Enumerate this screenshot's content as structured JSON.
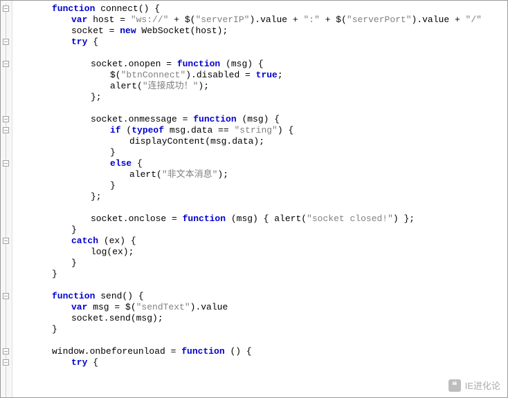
{
  "code": {
    "lines": [
      {
        "indent": 2,
        "tokens": [
          {
            "t": "kw",
            "v": "function"
          },
          {
            "t": "pl",
            "v": " connect() {"
          }
        ]
      },
      {
        "indent": 3,
        "tokens": [
          {
            "t": "kw",
            "v": "var"
          },
          {
            "t": "pl",
            "v": " host = "
          },
          {
            "t": "str",
            "v": "\"ws://\""
          },
          {
            "t": "pl",
            "v": " + $("
          },
          {
            "t": "str",
            "v": "\"serverIP\""
          },
          {
            "t": "pl",
            "v": ").value + "
          },
          {
            "t": "str",
            "v": "\":\""
          },
          {
            "t": "pl",
            "v": " + $("
          },
          {
            "t": "str",
            "v": "\"serverPort\""
          },
          {
            "t": "pl",
            "v": ").value + "
          },
          {
            "t": "str",
            "v": "\"/\""
          }
        ]
      },
      {
        "indent": 3,
        "tokens": [
          {
            "t": "pl",
            "v": "socket = "
          },
          {
            "t": "kw",
            "v": "new"
          },
          {
            "t": "pl",
            "v": " WebSocket(host);"
          }
        ]
      },
      {
        "indent": 3,
        "tokens": [
          {
            "t": "kw",
            "v": "try"
          },
          {
            "t": "pl",
            "v": " {"
          }
        ]
      },
      {
        "indent": 0,
        "tokens": []
      },
      {
        "indent": 4,
        "tokens": [
          {
            "t": "pl",
            "v": "socket.onopen = "
          },
          {
            "t": "kw",
            "v": "function"
          },
          {
            "t": "pl",
            "v": " (msg) {"
          }
        ]
      },
      {
        "indent": 5,
        "tokens": [
          {
            "t": "pl",
            "v": "$("
          },
          {
            "t": "str",
            "v": "\"btnConnect\""
          },
          {
            "t": "pl",
            "v": ").disabled = "
          },
          {
            "t": "kw",
            "v": "true"
          },
          {
            "t": "pl",
            "v": ";"
          }
        ]
      },
      {
        "indent": 5,
        "tokens": [
          {
            "t": "pl",
            "v": "alert("
          },
          {
            "t": "str",
            "v": "\"连接成功！\""
          },
          {
            "t": "pl",
            "v": ");"
          }
        ]
      },
      {
        "indent": 4,
        "tokens": [
          {
            "t": "pl",
            "v": "};"
          }
        ]
      },
      {
        "indent": 0,
        "tokens": []
      },
      {
        "indent": 4,
        "tokens": [
          {
            "t": "pl",
            "v": "socket.onmessage = "
          },
          {
            "t": "kw",
            "v": "function"
          },
          {
            "t": "pl",
            "v": " (msg) {"
          }
        ]
      },
      {
        "indent": 5,
        "tokens": [
          {
            "t": "kw",
            "v": "if"
          },
          {
            "t": "pl",
            "v": " ("
          },
          {
            "t": "kw",
            "v": "typeof"
          },
          {
            "t": "pl",
            "v": " msg.data == "
          },
          {
            "t": "str",
            "v": "\"string\""
          },
          {
            "t": "pl",
            "v": ") {"
          }
        ]
      },
      {
        "indent": 6,
        "tokens": [
          {
            "t": "pl",
            "v": "displayContent(msg.data);"
          }
        ]
      },
      {
        "indent": 5,
        "tokens": [
          {
            "t": "pl",
            "v": "}"
          }
        ]
      },
      {
        "indent": 5,
        "tokens": [
          {
            "t": "kw",
            "v": "else"
          },
          {
            "t": "pl",
            "v": " {"
          }
        ]
      },
      {
        "indent": 6,
        "tokens": [
          {
            "t": "pl",
            "v": "alert("
          },
          {
            "t": "str",
            "v": "\"非文本消息\""
          },
          {
            "t": "pl",
            "v": ");"
          }
        ]
      },
      {
        "indent": 5,
        "tokens": [
          {
            "t": "pl",
            "v": "}"
          }
        ]
      },
      {
        "indent": 4,
        "tokens": [
          {
            "t": "pl",
            "v": "};"
          }
        ]
      },
      {
        "indent": 0,
        "tokens": []
      },
      {
        "indent": 4,
        "tokens": [
          {
            "t": "pl",
            "v": "socket.onclose = "
          },
          {
            "t": "kw",
            "v": "function"
          },
          {
            "t": "pl",
            "v": " (msg) { alert("
          },
          {
            "t": "str",
            "v": "\"socket closed!\""
          },
          {
            "t": "pl",
            "v": ") };"
          }
        ]
      },
      {
        "indent": 3,
        "tokens": [
          {
            "t": "pl",
            "v": "}"
          }
        ]
      },
      {
        "indent": 3,
        "tokens": [
          {
            "t": "kw",
            "v": "catch"
          },
          {
            "t": "pl",
            "v": " (ex) {"
          }
        ]
      },
      {
        "indent": 4,
        "tokens": [
          {
            "t": "pl",
            "v": "log(ex);"
          }
        ]
      },
      {
        "indent": 3,
        "tokens": [
          {
            "t": "pl",
            "v": "}"
          }
        ]
      },
      {
        "indent": 2,
        "tokens": [
          {
            "t": "pl",
            "v": "}"
          }
        ]
      },
      {
        "indent": 0,
        "tokens": []
      },
      {
        "indent": 2,
        "tokens": [
          {
            "t": "kw",
            "v": "function"
          },
          {
            "t": "pl",
            "v": " send() {"
          }
        ]
      },
      {
        "indent": 3,
        "tokens": [
          {
            "t": "kw",
            "v": "var"
          },
          {
            "t": "pl",
            "v": " msg = $("
          },
          {
            "t": "str",
            "v": "\"sendText\""
          },
          {
            "t": "pl",
            "v": ").value"
          }
        ]
      },
      {
        "indent": 3,
        "tokens": [
          {
            "t": "pl",
            "v": "socket.send(msg);"
          }
        ]
      },
      {
        "indent": 2,
        "tokens": [
          {
            "t": "pl",
            "v": "}"
          }
        ]
      },
      {
        "indent": 0,
        "tokens": []
      },
      {
        "indent": 2,
        "tokens": [
          {
            "t": "pl",
            "v": "window.onbeforeunload = "
          },
          {
            "t": "kw",
            "v": "function"
          },
          {
            "t": "pl",
            "v": " () {"
          }
        ]
      },
      {
        "indent": 3,
        "tokens": [
          {
            "t": "kw",
            "v": "try"
          },
          {
            "t": "pl",
            "v": " {"
          }
        ]
      }
    ]
  },
  "gutter": {
    "marks": [
      {
        "line": 0,
        "type": "minus"
      },
      {
        "line": 3,
        "type": "minus"
      },
      {
        "line": 5,
        "type": "minus"
      },
      {
        "line": 10,
        "type": "minus"
      },
      {
        "line": 11,
        "type": "minus"
      },
      {
        "line": 14,
        "type": "minus"
      },
      {
        "line": 21,
        "type": "minus"
      },
      {
        "line": 26,
        "type": "minus"
      },
      {
        "line": 31,
        "type": "minus"
      },
      {
        "line": 32,
        "type": "minus"
      }
    ]
  },
  "watermark": {
    "text": "IE进化论"
  }
}
